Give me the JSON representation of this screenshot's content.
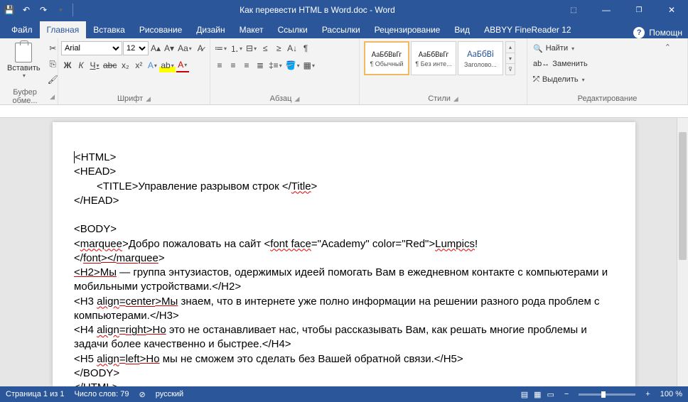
{
  "title": "Как перевести HTML в Word.doc  -  Word",
  "tabs": {
    "file": "Файл",
    "home": "Главная",
    "insert": "Вставка",
    "draw": "Рисование",
    "design": "Дизайн",
    "layout": "Макет",
    "references": "Ссылки",
    "mailings": "Рассылки",
    "review": "Рецензирование",
    "view": "Вид",
    "abbyy": "ABBYY FineReader 12",
    "help": "Помощн"
  },
  "clipboard": {
    "paste": "Вставить",
    "label": "Буфер обме..."
  },
  "font": {
    "name": "Arial",
    "size": "12",
    "label": "Шрифт"
  },
  "paragraph": {
    "label": "Абзац"
  },
  "styles": {
    "label": "Стили",
    "s1": "¶ Обычный",
    "s2": "¶ Без инте...",
    "s3": "Заголово...",
    "preview": "АаБбВвГг",
    "preview_h": "АаБбВі"
  },
  "editing": {
    "label": "Редактирование",
    "find": "Найти",
    "replace": "Заменить",
    "select": "Выделить"
  },
  "doc": {
    "l1": "<HTML>",
    "l2": "<HEAD>",
    "l3a": "<TITLE>Управление разрывом строк </",
    "l3b": "Title",
    "l3c": ">",
    "l4": "</HEAD>",
    "l5": "<BODY>",
    "l6a": "<",
    "l6b": "marquee",
    "l6c": ">Добро пожаловать на сайт <",
    "l6d": "font face",
    "l6e": "=\"Academy\" color=\"Red\">",
    "l6f": "Lumpics",
    "l6g": "!",
    "l7a": "</",
    "l7b": "font",
    "l7c": "></",
    "l7d": "marquee",
    "l7e": ">",
    "l8a": "<H2>",
    "l8b": "Мы",
    "l8c": " — группа энтузиастов, одержимых идеей помогать Вам в ежедневном контакте с компьютерами и мобильными устройствами.</H2>",
    "l9a": "<H3 ",
    "l9b": "align",
    "l9c": "=",
    "l9d": "center",
    "l9e": ">",
    "l9f": "Мы",
    "l9g": " знаем, что в интернете уже полно информации на решении разного рода проблем с компьютерами.</H3>",
    "l10a": "<H4 ",
    "l10b": "align",
    "l10c": "=",
    "l10d": "right",
    "l10e": ">",
    "l10f": "Но",
    "l10g": " это не останавливает нас, чтобы рассказывать Вам, как решать многие проблемы и задачи более качественно и быстрее.</H4>",
    "l11a": "<H5 ",
    "l11b": "align",
    "l11c": "=",
    "l11d": "left",
    "l11e": ">",
    "l11f": "Но",
    "l11g": " мы не сможем это сделать без Вашей обратной связи.</H5>",
    "l12": "</BODY>",
    "l13": "</HTML>"
  },
  "status": {
    "page": "Страница 1 из 1",
    "words": "Число слов: 79",
    "lang": "русский",
    "zoom": "100 %"
  }
}
